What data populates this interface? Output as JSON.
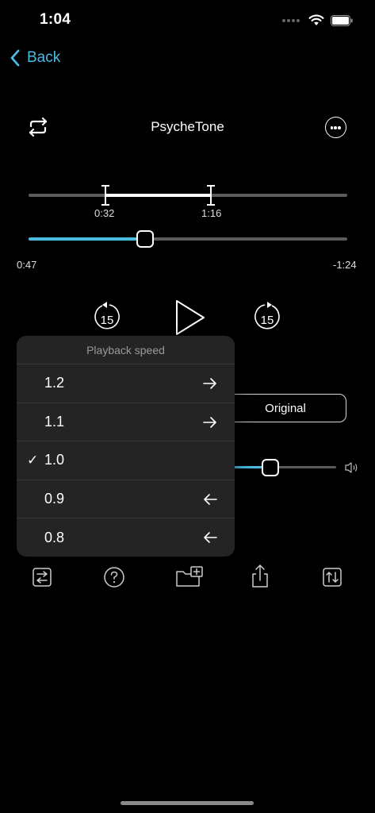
{
  "status": {
    "time": "1:04",
    "battery_icon": "battery-icon",
    "wifi_icon": "wifi-icon"
  },
  "nav": {
    "back_label": "Back",
    "back_icon": "chevron-left-icon",
    "accent": "#4bbbe3"
  },
  "header": {
    "title": "PsycheTone"
  },
  "loop": {
    "start_label": "0:32",
    "end_label": "1:16"
  },
  "playback": {
    "elapsed": "0:47",
    "remaining": "-1:24",
    "skip_back_label": "15",
    "skip_forward_label": "15"
  },
  "original_button": {
    "label": "Original"
  },
  "speed_menu": {
    "title": "Playback speed",
    "options": [
      {
        "label": "1.2",
        "arrow": "right-arrow-icon"
      },
      {
        "label": "1.1",
        "arrow": "right-arrow-icon"
      },
      {
        "label": "1.0",
        "selected": true,
        "check": "✓"
      },
      {
        "label": "0.9",
        "arrow": "left-arrow-icon"
      },
      {
        "label": "0.8",
        "arrow": "left-arrow-icon"
      }
    ]
  },
  "toolbar": {
    "items": [
      "swap-icon",
      "help-icon",
      "folder-add-icon",
      "share-icon",
      "sort-icon"
    ]
  }
}
